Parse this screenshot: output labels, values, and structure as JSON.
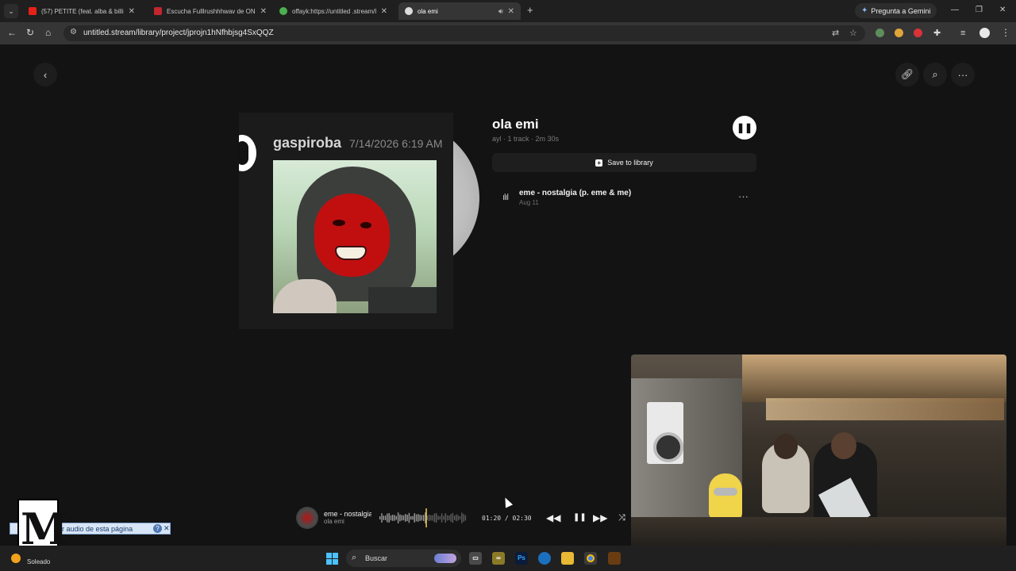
{
  "browser": {
    "tabs": [
      {
        "title": "(57) PETITE (feat. alba & billion",
        "favicon": "#e62117",
        "audio": false
      },
      {
        "title": "Escucha Fulllrushhhwav de ON",
        "favicon": "#c2262e",
        "audio": false
      },
      {
        "title": "offayk:https://untitled .stream/li",
        "favicon": "#4caf50",
        "audio": false
      },
      {
        "title": "ola emi",
        "favicon": "#dcdcdc",
        "audio": true
      }
    ],
    "gemini_label": "Pregunta a Gemini",
    "url": "untitled.stream/library/project/jprojn1hNfhbjsg4SxQQZ"
  },
  "project": {
    "title": "ola emi",
    "meta": "ayl · 1 track · 2m 30s",
    "save_label": "Save to library",
    "cover": {
      "username": "gaspiroba",
      "date": "7/14/2026 6:19 AM"
    },
    "tracks": [
      {
        "name": "eme - nostalgia (p. eme & me)",
        "date": "Aug 11"
      }
    ]
  },
  "player": {
    "title": "eme - nostalgia",
    "artist": "ola emi",
    "time": "01:20 / 02:30",
    "progress": 0.53
  },
  "overlay": {
    "audio_prompt": "ar audio de esta página"
  },
  "taskbar": {
    "weather": "Soleado",
    "search_placeholder": "Buscar"
  },
  "colors": {
    "page_bg": "#131313",
    "accent": "#f2c94c"
  }
}
